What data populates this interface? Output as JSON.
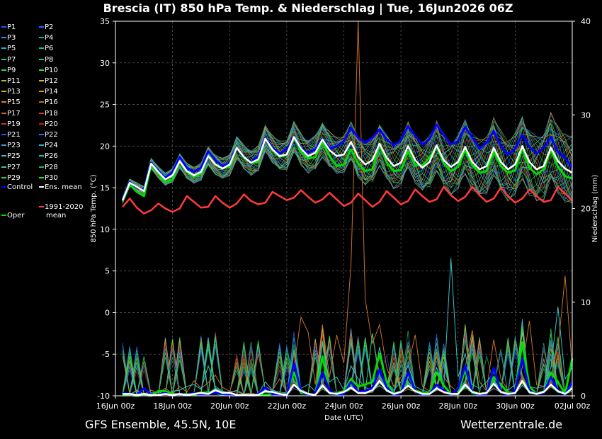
{
  "title": "Brescia  (IT)  850 hPa Temp. & Niederschlag | Tue, 16Jun2026 06Z",
  "footer": {
    "left": "GFS Ensemble, 45.5N, 10E",
    "right": "Wetterzentrale.de"
  },
  "colors": {
    "background": "#000000",
    "grid": "#555555",
    "control": "#0000ff",
    "ens_mean": "#ffffff",
    "oper": "#00dd00",
    "clim": "#ff3b3b"
  },
  "legend": [
    {
      "label": "P1",
      "color": "#3050ff"
    },
    {
      "label": "P2",
      "color": "#2c64ff"
    },
    {
      "label": "P3",
      "color": "#3a8cff"
    },
    {
      "label": "P4",
      "color": "#2aa0c8"
    },
    {
      "label": "P5",
      "color": "#20b4c0"
    },
    {
      "label": "P6",
      "color": "#18c08a"
    },
    {
      "label": "P7",
      "color": "#30c0a0"
    },
    {
      "label": "P8",
      "color": "#28b878"
    },
    {
      "label": "P9",
      "color": "#30d060"
    },
    {
      "label": "P10",
      "color": "#3cdc3c"
    },
    {
      "label": "P11",
      "color": "#a8c040"
    },
    {
      "label": "P12",
      "color": "#c8b840"
    },
    {
      "label": "P13",
      "color": "#d0a838"
    },
    {
      "label": "P14",
      "color": "#d89030"
    },
    {
      "label": "P15",
      "color": "#d08040"
    },
    {
      "label": "P16",
      "color": "#b87030"
    },
    {
      "label": "P17",
      "color": "#c86028"
    },
    {
      "label": "P18",
      "color": "#c04030"
    },
    {
      "label": "P19",
      "color": "#c83030"
    },
    {
      "label": "P20",
      "color": "#b02020"
    },
    {
      "label": "P21",
      "color": "#3848ff"
    },
    {
      "label": "P22",
      "color": "#3070e0"
    },
    {
      "label": "P23",
      "color": "#4898d8"
    },
    {
      "label": "P24",
      "color": "#38a8d0"
    },
    {
      "label": "P25",
      "color": "#38c0c8"
    },
    {
      "label": "P26",
      "color": "#20c8a0"
    },
    {
      "label": "P27",
      "color": "#38c890"
    },
    {
      "label": "P28",
      "color": "#28b868"
    },
    {
      "label": "P29",
      "color": "#38d040"
    },
    {
      "label": "P30",
      "color": "#30e030"
    },
    {
      "label": "Control",
      "color": "#0000ff"
    },
    {
      "label": "Ens. mean",
      "color": "#ffffff"
    },
    {
      "label": "1991-2020",
      "label2": "mean",
      "color": "#ff3b3b"
    },
    {
      "label": "Oper",
      "color": "#00dd00"
    }
  ],
  "chart_data": {
    "type": "line",
    "title": "Brescia  (IT)  850 hPa Temp. & Niederschlag | Tue, 16Jun2026 06Z",
    "xlabel": "Date (UTC)",
    "ylabel": "850 hPa Temp. (°C)",
    "y2label": "Niederschlag (mm)",
    "ylim": [
      -10,
      35
    ],
    "y2lim": [
      0,
      40
    ],
    "yticks": [
      "-10",
      "-5",
      "0",
      "5",
      "10",
      "15",
      "20",
      "25",
      "30",
      "35"
    ],
    "y2ticks": [
      "0",
      "10",
      "20",
      "30",
      "40"
    ],
    "xticks": [
      "16Jun 00z",
      "18Jun 00z",
      "20Jun 00z",
      "22Jun 00z",
      "24Jun 00z",
      "26Jun 00z",
      "28Jun 00z",
      "30Jun 00z",
      "02Jul 00z"
    ],
    "xrange_hours": [
      0,
      384
    ],
    "grid": true,
    "temperature_x_hours": [
      6,
      12,
      18,
      24,
      30,
      36,
      42,
      48,
      54,
      60,
      66,
      72,
      78,
      84,
      90,
      96,
      102,
      108,
      114,
      120,
      126,
      132,
      138,
      144,
      150,
      156,
      162,
      168,
      174,
      180,
      186,
      192,
      198,
      204,
      210,
      216,
      222,
      228,
      234,
      240,
      246,
      252,
      258,
      264,
      270,
      276,
      282,
      288,
      294,
      300,
      306,
      312,
      318,
      324,
      330,
      336,
      342,
      348,
      354,
      360,
      366,
      372,
      378,
      384
    ],
    "series": [
      {
        "name": "Control",
        "axis": "temperature",
        "values": [
          13.6,
          15.7,
          15.0,
          14.8,
          18.0,
          17.0,
          16.2,
          16.9,
          18.7,
          17.4,
          16.9,
          17.4,
          19.4,
          18.3,
          17.6,
          18.0,
          19.8,
          18.7,
          18.1,
          18.8,
          21.0,
          19.8,
          19.1,
          19.6,
          21.1,
          19.7,
          19.2,
          19.6,
          20.9,
          19.7,
          20.0,
          20.6,
          22.2,
          21.0,
          20.4,
          21.0,
          22.0,
          20.8,
          20.1,
          20.7,
          22.4,
          21.2,
          20.2,
          20.8,
          22.6,
          21.3,
          20.2,
          20.6,
          22.3,
          21.0,
          19.7,
          20.4,
          21.8,
          20.0,
          19.0,
          19.7,
          21.4,
          19.9,
          19.1,
          19.8,
          21.1,
          19.3,
          18.6,
          17.4
        ]
      },
      {
        "name": "Ens. mean",
        "axis": "temperature",
        "values": [
          13.5,
          15.6,
          15.1,
          14.6,
          17.9,
          16.9,
          16.0,
          16.5,
          18.2,
          17.0,
          16.5,
          16.9,
          18.8,
          17.8,
          17.3,
          17.8,
          19.8,
          18.7,
          18.0,
          18.4,
          20.9,
          19.6,
          18.8,
          19.0,
          21.1,
          19.7,
          18.8,
          19.2,
          20.8,
          19.5,
          18.8,
          19.0,
          20.5,
          18.7,
          17.8,
          18.3,
          20.3,
          18.6,
          17.6,
          18.0,
          20.0,
          18.3,
          17.4,
          18.1,
          20.1,
          18.3,
          17.5,
          18.1,
          19.9,
          18.1,
          17.2,
          17.6,
          19.8,
          18.1,
          17.2,
          17.8,
          20.0,
          18.1,
          17.2,
          17.6,
          19.8,
          18.2,
          17.3,
          16.8
        ]
      },
      {
        "name": "Oper",
        "axis": "temperature",
        "values": [
          13.4,
          15.4,
          14.5,
          14.0,
          17.8,
          16.7,
          15.7,
          16.0,
          18.2,
          16.9,
          16.3,
          16.7,
          19.0,
          17.8,
          17.3,
          17.6,
          19.8,
          18.6,
          18.0,
          18.1,
          21.0,
          19.5,
          18.7,
          19.0,
          21.1,
          19.3,
          18.5,
          18.7,
          20.5,
          18.8,
          17.6,
          17.8,
          19.6,
          17.9,
          17.0,
          17.2,
          20.2,
          18.0,
          17.0,
          17.1,
          19.4,
          17.7,
          17.7,
          18.6,
          20.0,
          17.9,
          17.0,
          17.5,
          19.5,
          17.7,
          16.8,
          17.0,
          19.3,
          17.6,
          16.8,
          17.1,
          19.8,
          17.4,
          16.6,
          17.2,
          19.5,
          17.5,
          16.4,
          16.1
        ]
      },
      {
        "name": "1991-2020 mean",
        "axis": "temperature",
        "values": [
          12.7,
          13.7,
          12.6,
          11.9,
          12.3,
          13.1,
          12.5,
          12.1,
          12.5,
          14.0,
          13.3,
          12.6,
          12.7,
          14.0,
          13.2,
          12.6,
          13.1,
          14.2,
          13.4,
          13.0,
          13.2,
          14.5,
          14.0,
          13.5,
          13.8,
          14.7,
          13.9,
          13.2,
          13.6,
          14.4,
          13.6,
          12.8,
          13.2,
          14.3,
          13.5,
          12.7,
          13.3,
          14.6,
          13.8,
          13.0,
          13.4,
          14.8,
          14.0,
          13.3,
          13.6,
          15.1,
          14.1,
          13.4,
          13.9,
          15.1,
          14.1,
          13.3,
          13.7,
          15.0,
          14.0,
          13.2,
          13.7,
          14.8,
          14.0,
          13.3,
          13.5,
          15.1,
          14.3,
          13.4
        ]
      },
      {
        "name": "Ens. mean precip",
        "axis": "precipitation",
        "values": [
          0.2,
          0.2,
          0.1,
          0.2,
          0.1,
          0.1,
          0.2,
          0.1,
          0.2,
          0.1,
          0.2,
          0.3,
          0.2,
          0.6,
          0.3,
          0.3,
          0.1,
          0.1,
          0.1,
          0.1,
          0.5,
          0.4,
          0.2,
          0.1,
          1.2,
          0.5,
          0.2,
          0.1,
          1.1,
          0.3,
          0.2,
          0.4,
          0.9,
          0.3,
          0.3,
          0.6,
          1.6,
          0.6,
          0.2,
          0.4,
          1.1,
          0.5,
          0.2,
          0.2,
          0.8,
          0.4,
          0.2,
          0.2,
          1.2,
          0.4,
          0.2,
          0.3,
          1.3,
          0.4,
          0.2,
          0.3,
          1.6,
          0.4,
          0.2,
          0.4,
          1.2,
          0.5,
          0.2,
          0.8
        ]
      },
      {
        "name": "Control precip",
        "axis": "precipitation",
        "values": [
          0.3,
          0.2,
          0.1,
          0.8,
          0.1,
          0.1,
          0.3,
          0.0,
          0.2,
          0.1,
          0.3,
          0.1,
          0.2,
          0.3,
          0.2,
          0.1,
          0.0,
          0.1,
          0.0,
          0.2,
          0.9,
          0.2,
          0.1,
          0.0,
          3.5,
          0.5,
          0.1,
          0.2,
          2.5,
          0.6,
          0.1,
          0.2,
          1.5,
          0.4,
          0.5,
          0.8,
          2.8,
          0.9,
          0.1,
          0.3,
          2.5,
          0.5,
          0.1,
          0.2,
          1.2,
          0.6,
          0.1,
          0.8,
          3.2,
          0.4,
          0.1,
          0.2,
          3.0,
          0.4,
          0.1,
          0.6,
          4.0,
          0.5,
          0.2,
          0.3,
          2.0,
          0.6,
          0.1,
          1.5
        ]
      },
      {
        "name": "Oper precip",
        "axis": "precipitation",
        "values": [
          0.1,
          0.1,
          0.0,
          0.1,
          0.0,
          0.5,
          0.5,
          0.2,
          0.1,
          0.2,
          0.1,
          0.3,
          0.4,
          0.3,
          0.1,
          0.2,
          0.0,
          0.1,
          0.0,
          0.1,
          0.1,
          0.2,
          0.1,
          0.2,
          2.5,
          0.3,
          0.2,
          0.1,
          4.2,
          0.4,
          0.3,
          0.5,
          1.8,
          1.0,
          1.2,
          1.5,
          4.5,
          1.5,
          0.2,
          0.4,
          2.2,
          0.6,
          0.3,
          0.3,
          2.5,
          1.1,
          0.2,
          0.2,
          2.8,
          0.3,
          0.1,
          0.2,
          2.0,
          1.2,
          0.3,
          0.5,
          5.7,
          1.0,
          0.2,
          0.3,
          2.5,
          1.5,
          0.2,
          4.0
        ]
      },
      {
        "name": "P16 precip",
        "axis": "precipitation",
        "values": [
          0.4,
          0.2,
          0.5,
          0.2,
          0.6,
          0.3,
          0.8,
          0.2,
          1.0,
          0.4,
          1.6,
          0.8,
          1.4,
          2.2,
          0.9,
          0.5,
          0.4,
          0.2,
          0.3,
          0.1,
          1.0,
          0.6,
          1.8,
          0.4,
          3.0,
          8.4,
          6.8,
          1.2,
          7.6,
          2.0,
          6.5,
          3.5,
          14.0,
          40.0,
          10.3,
          5.6,
          7.6,
          3.0,
          1.0,
          2.0,
          3.2,
          6.5,
          1.0,
          0.5,
          4.6,
          2.0,
          1.0,
          0.4,
          3.0,
          7.0,
          1.5,
          0.5,
          6.0,
          1.8,
          0.6,
          1.2,
          3.0,
          8.0,
          1.2,
          1.0,
          3.0,
          5.0,
          12.8,
          3.0
        ]
      },
      {
        "name": "P25 precip",
        "axis": "precipitation",
        "values": [
          0.2,
          0.1,
          0.6,
          0.2,
          0.3,
          0.4,
          0.2,
          0.5,
          0.6,
          1.0,
          1.2,
          0.7,
          3.2,
          1.0,
          0.5,
          0.3,
          0.6,
          0.2,
          0.1,
          0.2,
          1.5,
          0.6,
          0.4,
          0.3,
          3.5,
          0.8,
          1.2,
          0.5,
          5.8,
          1.5,
          2.0,
          0.6,
          3.2,
          1.8,
          0.9,
          0.6,
          5.2,
          1.5,
          0.6,
          1.5,
          3.2,
          1.0,
          0.6,
          0.4,
          3.0,
          1.0,
          14.7,
          2.0,
          4.5,
          1.2,
          0.8,
          1.5,
          2.5,
          1.0,
          0.6,
          1.2,
          4.0,
          1.0,
          0.8,
          1.0,
          3.0,
          9.5,
          1.8,
          3.0
        ]
      }
    ]
  }
}
